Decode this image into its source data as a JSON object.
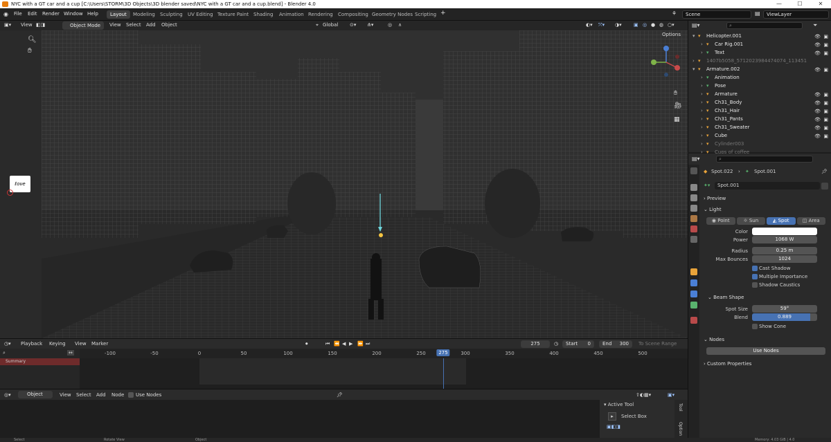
{
  "window": {
    "title": "NYC with a GT car and a cup [C:\\Users\\STORM\\3D Objects\\3D blender saved\\NYC with a GT car and a cup.blend] - Blender 4.0",
    "minimize": "—",
    "maximize": "☐",
    "close": "✕"
  },
  "menu": [
    "File",
    "Edit",
    "Render",
    "Window",
    "Help"
  ],
  "workspaces": [
    "Layout",
    "Modeling",
    "Sculpting",
    "UV Editing",
    "Texture Paint",
    "Shading",
    "Animation",
    "Rendering",
    "Compositing",
    "Geometry Nodes",
    "Scripting"
  ],
  "scene": "Scene",
  "view_layer": "ViewLayer",
  "viewport_header": {
    "view": "View",
    "mode": "Object Mode",
    "menus": [
      "View",
      "Select",
      "Add",
      "Object"
    ],
    "orientation": "Global",
    "options": "Options"
  },
  "timeline": {
    "menus": [
      "Playback",
      "Keying",
      "View",
      "Marker"
    ],
    "current_frame": "275",
    "start_label": "Start",
    "start": "0",
    "end_label": "End",
    "end": "300",
    "to_scene_range": "To Scene Range",
    "summary": "Summary",
    "ruler": [
      "-100",
      "-50",
      "0",
      "50",
      "100",
      "150",
      "200",
      "250",
      "275",
      "300",
      "350",
      "400",
      "450",
      "500"
    ]
  },
  "node_editor": {
    "type": "Object",
    "menus": [
      "View",
      "Select",
      "Add",
      "Node"
    ],
    "use_nodes": "Use Nodes",
    "active_tool": "Active Tool",
    "select_box": "Select Box",
    "side_tabs": [
      "Tool",
      "Option"
    ]
  },
  "status": [
    "Select",
    "Rotate View",
    "Object",
    "Memory: 4.03 GiB | 4.0"
  ],
  "outliner": {
    "rows": [
      {
        "name": "Helicopter.001",
        "indent": 1,
        "color": "#e8e8e8"
      },
      {
        "name": "Car Rig.001",
        "indent": 2,
        "color": "#e8e8e8"
      },
      {
        "name": "Text",
        "indent": 2,
        "color": "#e8e8e8"
      },
      {
        "name": "1407b5058_5712023984474074_113451",
        "indent": 1,
        "color": "#777777"
      },
      {
        "name": "Armature.002",
        "indent": 1,
        "color": "#e8e8e8"
      },
      {
        "name": "Animation",
        "indent": 2,
        "color": "#e8e8e8"
      },
      {
        "name": "Pose",
        "indent": 2,
        "color": "#e8e8e8"
      },
      {
        "name": "Armature",
        "indent": 2,
        "color": "#e8e8e8"
      },
      {
        "name": "Ch31_Body",
        "indent": 2,
        "color": "#e8e8e8"
      },
      {
        "name": "Ch31_Hair",
        "indent": 2,
        "color": "#e8e8e8"
      },
      {
        "name": "Ch31_Pants",
        "indent": 2,
        "color": "#e8e8e8"
      },
      {
        "name": "Ch31_Sweater",
        "indent": 2,
        "color": "#e8e8e8"
      },
      {
        "name": "Cube",
        "indent": 2,
        "color": "#e8e8e8"
      },
      {
        "name": "Cylinder003",
        "indent": 2,
        "color": "#777777"
      },
      {
        "name": "Cups of coffee",
        "indent": 2,
        "color": "#777777"
      }
    ]
  },
  "properties": {
    "breadcrumb_object": "Spot.022",
    "breadcrumb_data": "Spot.001",
    "datablock": "Spot.001",
    "preview": "Preview",
    "light": "Light",
    "light_types": [
      "Point",
      "Sun",
      "Spot",
      "Area"
    ],
    "active_type": "Spot",
    "color_label": "Color",
    "power_label": "Power",
    "power": "1068 W",
    "radius_label": "Radius",
    "radius": "0.25 m",
    "max_bounces_label": "Max Bounces",
    "max_bounces": "1024",
    "cast_shadow": "Cast Shadow",
    "multiple_importance": "Multiple Importance",
    "shadow_caustics": "Shadow Caustics",
    "beam_shape": "Beam Shape",
    "spot_size_label": "Spot Size",
    "spot_size": "59°",
    "blend_label": "Blend",
    "blend": "0.889",
    "show_cone": "Show Cone",
    "nodes": "Nodes",
    "use_nodes": "Use Nodes",
    "custom_properties": "Custom Properties"
  },
  "colors": {
    "accent": "#4772b3",
    "selected_light": "#f5c542",
    "orange": "#e8a33a",
    "green": "#59b36e"
  }
}
